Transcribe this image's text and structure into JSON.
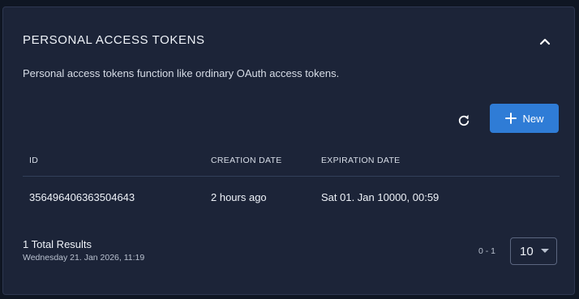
{
  "card": {
    "title": "PERSONAL ACCESS TOKENS",
    "description": "Personal access tokens function like ordinary OAuth access tokens."
  },
  "toolbar": {
    "refresh_icon": "refresh-icon",
    "new_label": "New",
    "new_icon": "plus-icon"
  },
  "table": {
    "headers": {
      "id": "ID",
      "created": "CREATION DATE",
      "expires": "EXPIRATION DATE"
    },
    "rows": [
      {
        "id": "356496406363504643",
        "created": "2 hours ago",
        "expires": "Sat 01. Jan 10000, 00:59"
      }
    ]
  },
  "footer": {
    "total": "1 Total Results",
    "timestamp": "Wednesday 21. Jan 2026, 11:19",
    "range": "0 - 1",
    "page_size": "10"
  },
  "colors": {
    "background": "#0f1623",
    "card": "#1c2438",
    "accent": "#2f7cd6"
  }
}
